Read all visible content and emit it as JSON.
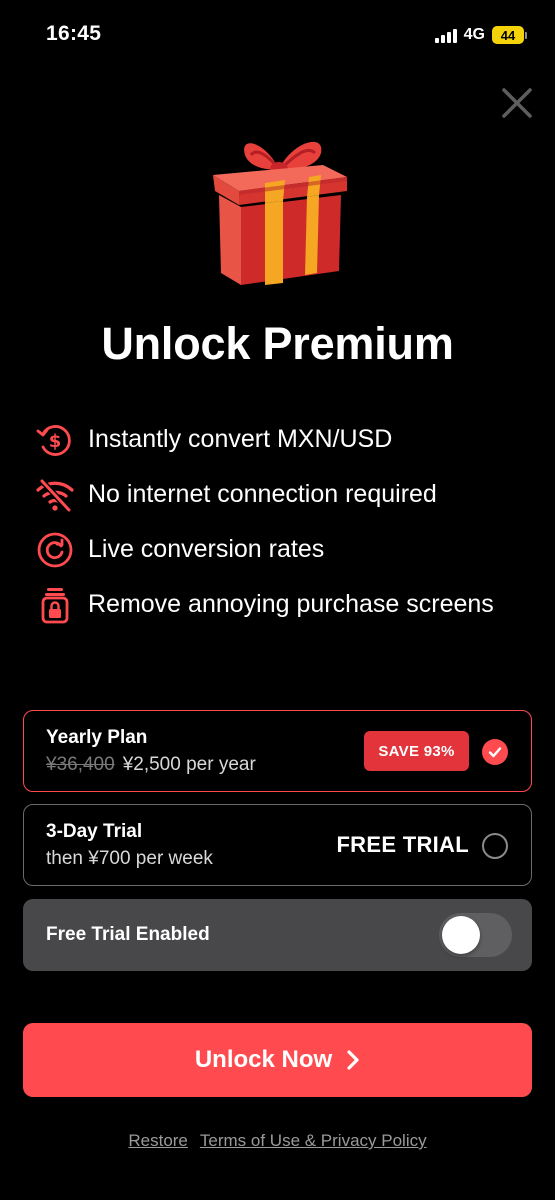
{
  "status_bar": {
    "time": "16:45",
    "network": "4G",
    "battery": "44",
    "battery_color": "#f5d30a"
  },
  "close": {
    "icon": "close-icon"
  },
  "hero": {
    "icon": "gift-icon",
    "title": "Unlock Premium"
  },
  "features": [
    {
      "icon": "currency-exchange-icon",
      "text": "Instantly convert MXN/USD"
    },
    {
      "icon": "wifi-off-icon",
      "text": "No internet connection required"
    },
    {
      "icon": "refresh-icon",
      "text": "Live conversion rates"
    },
    {
      "icon": "lock-icon",
      "text": "Remove annoying purchase screens"
    }
  ],
  "plans": {
    "yearly": {
      "title": "Yearly Plan",
      "old_price": "¥36,400",
      "price": "¥2,500 per year",
      "badge": "SAVE 93%",
      "selected": true
    },
    "trial": {
      "title": "3-Day Trial",
      "subtitle": "then ¥700 per week",
      "label": "FREE TRIAL",
      "selected": false
    }
  },
  "toggle": {
    "label": "Free Trial Enabled",
    "on": false
  },
  "cta": {
    "label": "Unlock Now"
  },
  "footer": {
    "restore": "Restore",
    "terms": "Terms of Use & Privacy Policy"
  },
  "colors": {
    "accent": "#ff4b4f",
    "badge": "#e2343a",
    "background": "#000000",
    "toggle_row": "#48484a"
  }
}
